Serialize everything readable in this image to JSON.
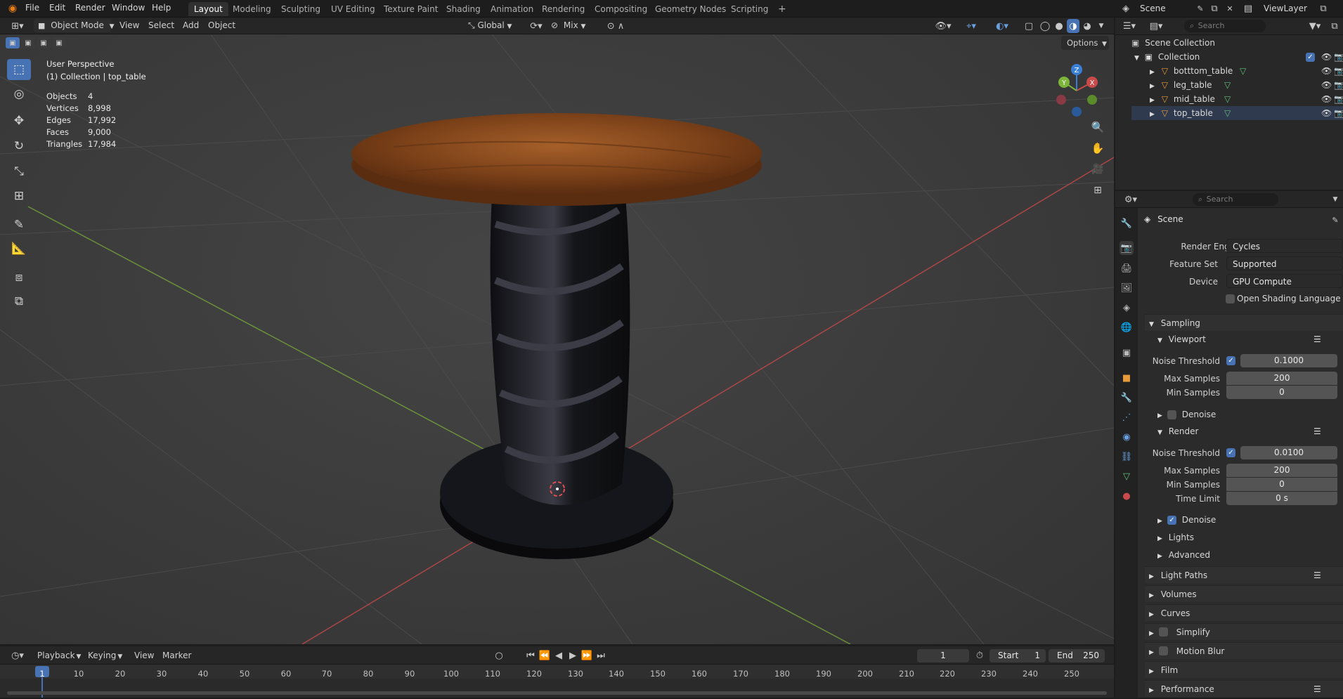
{
  "app": {
    "logo": "blender-logo-icon"
  },
  "menu": [
    "File",
    "Edit",
    "Render",
    "Window",
    "Help"
  ],
  "workspaces": [
    "Layout",
    "Modeling",
    "Sculpting",
    "UV Editing",
    "Texture Paint",
    "Shading",
    "Animation",
    "Rendering",
    "Compositing",
    "Geometry Nodes",
    "Scripting"
  ],
  "workspace_add": "+",
  "scene_selector": {
    "label": "Scene"
  },
  "viewlayer_selector": {
    "label": "ViewLayer"
  },
  "viewport_header": {
    "mode": "Object Mode",
    "menus": [
      "View",
      "Select",
      "Add",
      "Object"
    ],
    "orientation": "Global",
    "snap": "Mix",
    "options": "Options"
  },
  "viewport": {
    "title": "User Perspective",
    "subtitle": "(1) Collection | top_table",
    "stats": [
      {
        "k": "Objects",
        "v": "4"
      },
      {
        "k": "Vertices",
        "v": "8,998"
      },
      {
        "k": "Edges",
        "v": "17,992"
      },
      {
        "k": "Faces",
        "v": "9,000"
      },
      {
        "k": "Triangles",
        "v": "17,984"
      }
    ],
    "gizmo": {
      "x": "X",
      "y": "Y",
      "z": "Z"
    }
  },
  "outliner": {
    "search_placeholder": "Search",
    "root": "Scene Collection",
    "collection": "Collection",
    "objects": [
      "botttom_table",
      "leg_table",
      "mid_table",
      "top_table"
    ]
  },
  "properties": {
    "search_placeholder": "Search",
    "context": "Scene",
    "render_engine": {
      "label": "Render Engine",
      "value": "Cycles"
    },
    "feature_set": {
      "label": "Feature Set",
      "value": "Supported"
    },
    "device": {
      "label": "Device",
      "value": "GPU Compute"
    },
    "osl": {
      "label": "Open Shading Language",
      "checked": false
    },
    "sampling": {
      "title": "Sampling",
      "viewport": {
        "title": "Viewport",
        "noise_threshold": {
          "label": "Noise Threshold",
          "value": "0.1000",
          "enabled": true
        },
        "max_samples": {
          "label": "Max Samples",
          "value": "200"
        },
        "min_samples": {
          "label": "Min Samples",
          "value": "0"
        },
        "denoise": {
          "label": "Denoise",
          "checked": false
        }
      },
      "render": {
        "title": "Render",
        "noise_threshold": {
          "label": "Noise Threshold",
          "value": "0.0100",
          "enabled": true
        },
        "max_samples": {
          "label": "Max Samples",
          "value": "200"
        },
        "min_samples": {
          "label": "Min Samples",
          "value": "0"
        },
        "time_limit": {
          "label": "Time Limit",
          "value": "0 s"
        },
        "denoise": {
          "label": "Denoise",
          "checked": true
        }
      },
      "lights": "Lights",
      "advanced": "Advanced"
    },
    "sections": [
      "Light Paths",
      "Volumes",
      "Curves",
      "Simplify",
      "Motion Blur",
      "Film",
      "Performance"
    ]
  },
  "timeline": {
    "menus": [
      "Playback",
      "Keying",
      "View",
      "Marker"
    ],
    "current_frame": "1",
    "start_label": "Start",
    "start": "1",
    "end_label": "End",
    "end": "250",
    "ruler": [
      "1",
      "10",
      "20",
      "30",
      "40",
      "50",
      "60",
      "70",
      "80",
      "90",
      "100",
      "110",
      "120",
      "130",
      "140",
      "150",
      "160",
      "170",
      "180",
      "190",
      "200",
      "210",
      "220",
      "230",
      "240",
      "250"
    ]
  },
  "colors": {
    "accent": "#4772b3",
    "x_axis": "#c94a4a",
    "y_axis": "#7db43a",
    "z_axis": "#3a7fd6",
    "wood": "#8b4a1c"
  }
}
